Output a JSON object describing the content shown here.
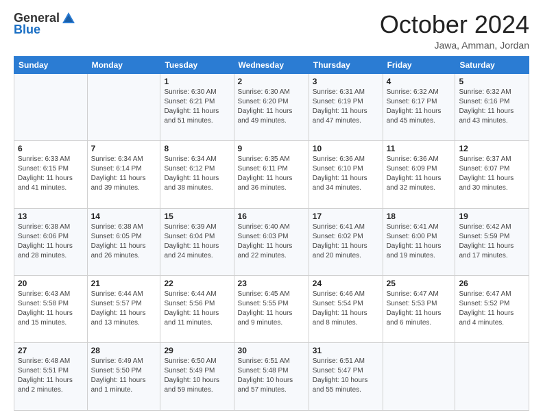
{
  "logo": {
    "text1": "General",
    "text2": "Blue"
  },
  "title": "October 2024",
  "location": "Jawa, Amman, Jordan",
  "weekdays": [
    "Sunday",
    "Monday",
    "Tuesday",
    "Wednesday",
    "Thursday",
    "Friday",
    "Saturday"
  ],
  "weeks": [
    [
      {
        "day": "",
        "sunrise": "",
        "sunset": "",
        "daylight": ""
      },
      {
        "day": "",
        "sunrise": "",
        "sunset": "",
        "daylight": ""
      },
      {
        "day": "1",
        "sunrise": "Sunrise: 6:30 AM",
        "sunset": "Sunset: 6:21 PM",
        "daylight": "Daylight: 11 hours and 51 minutes."
      },
      {
        "day": "2",
        "sunrise": "Sunrise: 6:30 AM",
        "sunset": "Sunset: 6:20 PM",
        "daylight": "Daylight: 11 hours and 49 minutes."
      },
      {
        "day": "3",
        "sunrise": "Sunrise: 6:31 AM",
        "sunset": "Sunset: 6:19 PM",
        "daylight": "Daylight: 11 hours and 47 minutes."
      },
      {
        "day": "4",
        "sunrise": "Sunrise: 6:32 AM",
        "sunset": "Sunset: 6:17 PM",
        "daylight": "Daylight: 11 hours and 45 minutes."
      },
      {
        "day": "5",
        "sunrise": "Sunrise: 6:32 AM",
        "sunset": "Sunset: 6:16 PM",
        "daylight": "Daylight: 11 hours and 43 minutes."
      }
    ],
    [
      {
        "day": "6",
        "sunrise": "Sunrise: 6:33 AM",
        "sunset": "Sunset: 6:15 PM",
        "daylight": "Daylight: 11 hours and 41 minutes."
      },
      {
        "day": "7",
        "sunrise": "Sunrise: 6:34 AM",
        "sunset": "Sunset: 6:14 PM",
        "daylight": "Daylight: 11 hours and 39 minutes."
      },
      {
        "day": "8",
        "sunrise": "Sunrise: 6:34 AM",
        "sunset": "Sunset: 6:12 PM",
        "daylight": "Daylight: 11 hours and 38 minutes."
      },
      {
        "day": "9",
        "sunrise": "Sunrise: 6:35 AM",
        "sunset": "Sunset: 6:11 PM",
        "daylight": "Daylight: 11 hours and 36 minutes."
      },
      {
        "day": "10",
        "sunrise": "Sunrise: 6:36 AM",
        "sunset": "Sunset: 6:10 PM",
        "daylight": "Daylight: 11 hours and 34 minutes."
      },
      {
        "day": "11",
        "sunrise": "Sunrise: 6:36 AM",
        "sunset": "Sunset: 6:09 PM",
        "daylight": "Daylight: 11 hours and 32 minutes."
      },
      {
        "day": "12",
        "sunrise": "Sunrise: 6:37 AM",
        "sunset": "Sunset: 6:07 PM",
        "daylight": "Daylight: 11 hours and 30 minutes."
      }
    ],
    [
      {
        "day": "13",
        "sunrise": "Sunrise: 6:38 AM",
        "sunset": "Sunset: 6:06 PM",
        "daylight": "Daylight: 11 hours and 28 minutes."
      },
      {
        "day": "14",
        "sunrise": "Sunrise: 6:38 AM",
        "sunset": "Sunset: 6:05 PM",
        "daylight": "Daylight: 11 hours and 26 minutes."
      },
      {
        "day": "15",
        "sunrise": "Sunrise: 6:39 AM",
        "sunset": "Sunset: 6:04 PM",
        "daylight": "Daylight: 11 hours and 24 minutes."
      },
      {
        "day": "16",
        "sunrise": "Sunrise: 6:40 AM",
        "sunset": "Sunset: 6:03 PM",
        "daylight": "Daylight: 11 hours and 22 minutes."
      },
      {
        "day": "17",
        "sunrise": "Sunrise: 6:41 AM",
        "sunset": "Sunset: 6:02 PM",
        "daylight": "Daylight: 11 hours and 20 minutes."
      },
      {
        "day": "18",
        "sunrise": "Sunrise: 6:41 AM",
        "sunset": "Sunset: 6:00 PM",
        "daylight": "Daylight: 11 hours and 19 minutes."
      },
      {
        "day": "19",
        "sunrise": "Sunrise: 6:42 AM",
        "sunset": "Sunset: 5:59 PM",
        "daylight": "Daylight: 11 hours and 17 minutes."
      }
    ],
    [
      {
        "day": "20",
        "sunrise": "Sunrise: 6:43 AM",
        "sunset": "Sunset: 5:58 PM",
        "daylight": "Daylight: 11 hours and 15 minutes."
      },
      {
        "day": "21",
        "sunrise": "Sunrise: 6:44 AM",
        "sunset": "Sunset: 5:57 PM",
        "daylight": "Daylight: 11 hours and 13 minutes."
      },
      {
        "day": "22",
        "sunrise": "Sunrise: 6:44 AM",
        "sunset": "Sunset: 5:56 PM",
        "daylight": "Daylight: 11 hours and 11 minutes."
      },
      {
        "day": "23",
        "sunrise": "Sunrise: 6:45 AM",
        "sunset": "Sunset: 5:55 PM",
        "daylight": "Daylight: 11 hours and 9 minutes."
      },
      {
        "day": "24",
        "sunrise": "Sunrise: 6:46 AM",
        "sunset": "Sunset: 5:54 PM",
        "daylight": "Daylight: 11 hours and 8 minutes."
      },
      {
        "day": "25",
        "sunrise": "Sunrise: 6:47 AM",
        "sunset": "Sunset: 5:53 PM",
        "daylight": "Daylight: 11 hours and 6 minutes."
      },
      {
        "day": "26",
        "sunrise": "Sunrise: 6:47 AM",
        "sunset": "Sunset: 5:52 PM",
        "daylight": "Daylight: 11 hours and 4 minutes."
      }
    ],
    [
      {
        "day": "27",
        "sunrise": "Sunrise: 6:48 AM",
        "sunset": "Sunset: 5:51 PM",
        "daylight": "Daylight: 11 hours and 2 minutes."
      },
      {
        "day": "28",
        "sunrise": "Sunrise: 6:49 AM",
        "sunset": "Sunset: 5:50 PM",
        "daylight": "Daylight: 11 hours and 1 minute."
      },
      {
        "day": "29",
        "sunrise": "Sunrise: 6:50 AM",
        "sunset": "Sunset: 5:49 PM",
        "daylight": "Daylight: 10 hours and 59 minutes."
      },
      {
        "day": "30",
        "sunrise": "Sunrise: 6:51 AM",
        "sunset": "Sunset: 5:48 PM",
        "daylight": "Daylight: 10 hours and 57 minutes."
      },
      {
        "day": "31",
        "sunrise": "Sunrise: 6:51 AM",
        "sunset": "Sunset: 5:47 PM",
        "daylight": "Daylight: 10 hours and 55 minutes."
      },
      {
        "day": "",
        "sunrise": "",
        "sunset": "",
        "daylight": ""
      },
      {
        "day": "",
        "sunrise": "",
        "sunset": "",
        "daylight": ""
      }
    ]
  ]
}
